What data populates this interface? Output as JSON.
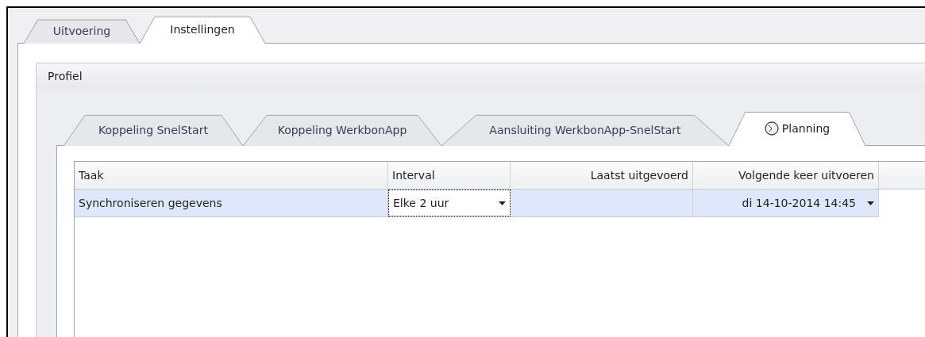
{
  "outer_tabs": [
    {
      "label": "Uitvoering",
      "selected": false
    },
    {
      "label": "Instellingen",
      "selected": true
    }
  ],
  "group": {
    "title": "Profiel"
  },
  "inner_tabs": [
    {
      "label": "Koppeling SnelStart",
      "selected": false,
      "kind": "text"
    },
    {
      "label": "Koppeling WerkbonApp",
      "selected": false,
      "kind": "text"
    },
    {
      "label": "Aansluiting WerkbonApp-SnelStart",
      "selected": false,
      "kind": "text"
    },
    {
      "label": "Planning",
      "selected": true,
      "kind": "clock"
    }
  ],
  "table": {
    "columns": [
      "Taak",
      "Interval",
      "Laatst uitgevoerd",
      "Volgende keer uitvoeren"
    ],
    "rows": [
      {
        "selected": true,
        "cells": [
          {
            "kind": "text",
            "value": "Synchroniseren gegevens"
          },
          {
            "kind": "dropdown",
            "value": "Elke 2 uur",
            "focused": true
          },
          {
            "kind": "empty"
          },
          {
            "kind": "dropdown",
            "value": "di 14-10-2014 14:45",
            "focused": false
          }
        ]
      }
    ]
  }
}
